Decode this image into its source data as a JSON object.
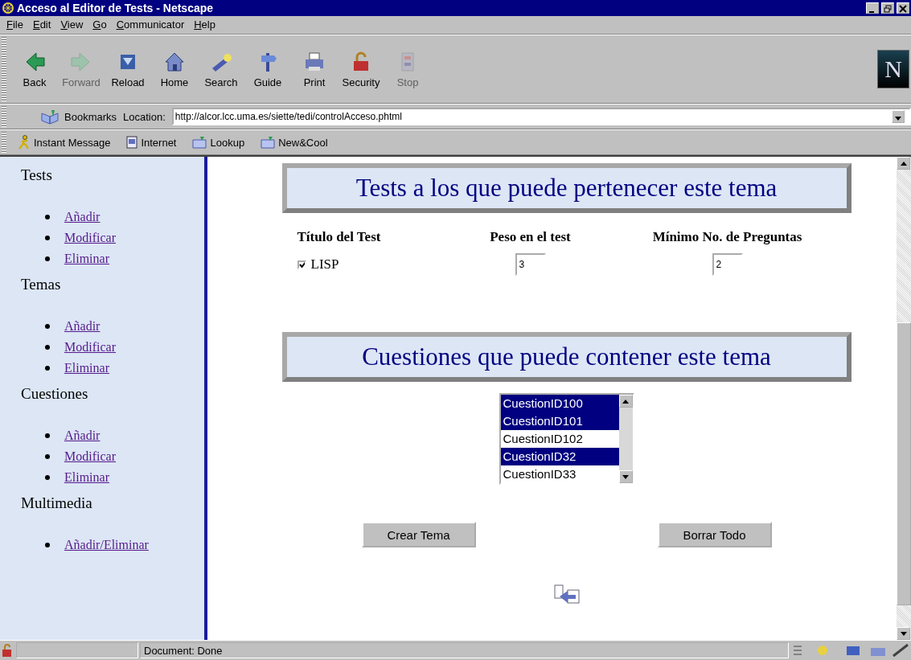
{
  "window": {
    "title": "Acceso al Editor de Tests - Netscape"
  },
  "menu": [
    "File",
    "Edit",
    "View",
    "Go",
    "Communicator",
    "Help"
  ],
  "toolbar": [
    {
      "label": "Back",
      "disabled": false
    },
    {
      "label": "Forward",
      "disabled": true
    },
    {
      "label": "Reload",
      "disabled": false
    },
    {
      "label": "Home",
      "disabled": false
    },
    {
      "label": "Search",
      "disabled": false
    },
    {
      "label": "Guide",
      "disabled": false
    },
    {
      "label": "Print",
      "disabled": false
    },
    {
      "label": "Security",
      "disabled": false
    },
    {
      "label": "Stop",
      "disabled": true
    }
  ],
  "logo": "N",
  "location_bar": {
    "bookmarks": "Bookmarks",
    "label": "Location:",
    "url": "http://alcor.lcc.uma.es/siette/tedi/controlAcceso.phtml"
  },
  "personal_toolbar": [
    "Instant Message",
    "Internet",
    "Lookup",
    "New&Cool"
  ],
  "sidebar": [
    {
      "title": "Tests",
      "links": [
        "Añadir",
        "Modificar",
        "Eliminar"
      ]
    },
    {
      "title": "Temas",
      "links": [
        "Añadir",
        "Modificar",
        "Eliminar"
      ]
    },
    {
      "title": "Cuestiones",
      "links": [
        "Añadir",
        "Modificar",
        "Eliminar"
      ]
    },
    {
      "title": "Multimedia",
      "links": [
        "Añadir/Eliminar"
      ]
    }
  ],
  "tests_section": {
    "heading": "Tests a los que puede pertenecer este tema",
    "columns": [
      "Título del Test",
      "Peso en el test",
      "Mínimo No. de Preguntas"
    ],
    "rows": [
      {
        "test": "LISP",
        "checked": true,
        "weight": "3",
        "min_questions": "2"
      }
    ]
  },
  "questions_section": {
    "heading": "Cuestiones que puede contener este tema",
    "items": [
      {
        "label": "CuestionID100",
        "selected": true
      },
      {
        "label": "CuestionID101",
        "selected": true
      },
      {
        "label": "CuestionID102",
        "selected": false
      },
      {
        "label": "CuestionID32",
        "selected": true
      },
      {
        "label": "CuestionID33",
        "selected": false
      }
    ]
  },
  "buttons": [
    "Crear Tema",
    "Borrar Todo"
  ],
  "status_bar": {
    "text": "Document: Done"
  }
}
